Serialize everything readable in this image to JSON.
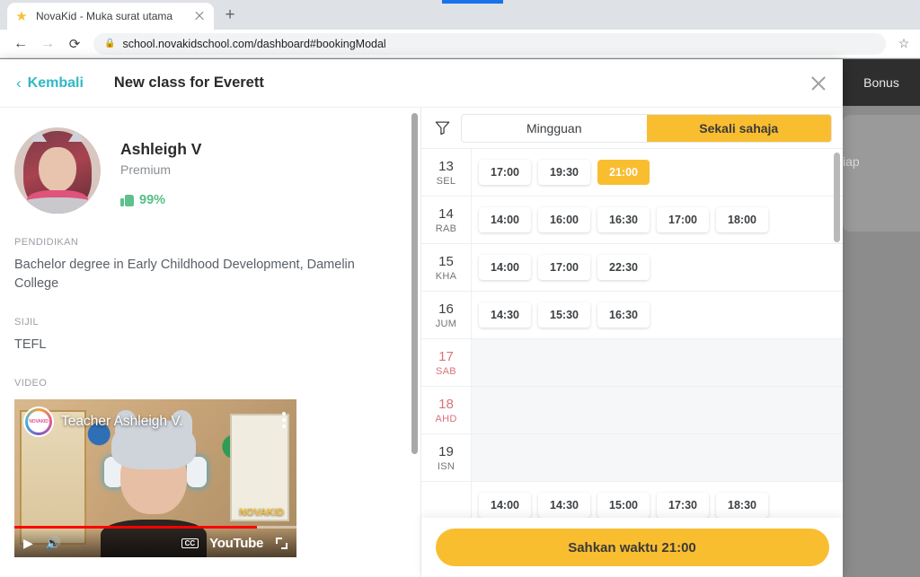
{
  "browser": {
    "tab": {
      "title": "NovaKid - Muka surat utama",
      "favicon": "star-icon"
    },
    "new_tab_label": "+",
    "nav": {
      "back": "←",
      "forward": "→",
      "reload": "⟳"
    },
    "omnibox": {
      "lock": "🔒",
      "url": "school.novakidschool.com/dashboard#bookingModal"
    },
    "bookmark_star": "☆"
  },
  "background": {
    "bonus_label": "Bonus",
    "partial_text": "iap"
  },
  "modal": {
    "back_label": "Kembali",
    "back_chevron": "‹",
    "title": "New class for Everett",
    "close_label": "×"
  },
  "teacher": {
    "name": "Ashleigh V",
    "plan": "Premium",
    "rating": "99%",
    "sections": [
      {
        "label": "PENDIDIKAN",
        "text": "Bachelor degree in Early Childhood Development, Damelin College"
      },
      {
        "label": "SIJIL",
        "text": "TEFL"
      }
    ],
    "video_section_label": "VIDEO",
    "video": {
      "title": "Teacher Ashleigh V.",
      "brand": "NOVAKID",
      "logo_text": "NOVAKID",
      "youtube_label": "YouTube",
      "cc_label": "CC",
      "play_icon": "▶",
      "volume_icon": "🔊",
      "progress_percent": 86
    }
  },
  "schedule": {
    "filter_icon": "funnel-icon",
    "tabs": [
      {
        "label": "Mingguan",
        "active": false
      },
      {
        "label": "Sekali sahaja",
        "active": true
      }
    ],
    "days": [
      {
        "num": "13",
        "dow": "SEL",
        "weekend": false,
        "slots": [
          {
            "time": "17:00",
            "selected": false
          },
          {
            "time": "19:30",
            "selected": false
          },
          {
            "time": "21:00",
            "selected": true
          }
        ]
      },
      {
        "num": "14",
        "dow": "RAB",
        "weekend": false,
        "slots": [
          {
            "time": "14:00",
            "selected": false
          },
          {
            "time": "16:00",
            "selected": false
          },
          {
            "time": "16:30",
            "selected": false
          },
          {
            "time": "17:00",
            "selected": false
          },
          {
            "time": "18:00",
            "selected": false
          }
        ]
      },
      {
        "num": "15",
        "dow": "KHA",
        "weekend": false,
        "slots": [
          {
            "time": "14:00",
            "selected": false
          },
          {
            "time": "17:00",
            "selected": false
          },
          {
            "time": "22:30",
            "selected": false
          }
        ]
      },
      {
        "num": "16",
        "dow": "JUM",
        "weekend": false,
        "slots": [
          {
            "time": "14:30",
            "selected": false
          },
          {
            "time": "15:30",
            "selected": false
          },
          {
            "time": "16:30",
            "selected": false
          }
        ]
      },
      {
        "num": "17",
        "dow": "SAB",
        "weekend": true,
        "slots": []
      },
      {
        "num": "18",
        "dow": "AHD",
        "weekend": true,
        "slots": []
      },
      {
        "num": "19",
        "dow": "ISN",
        "weekend": false,
        "slots": []
      },
      {
        "num": "",
        "dow": "",
        "weekend": false,
        "slots": [
          {
            "time": "14:00",
            "selected": false
          },
          {
            "time": "14:30",
            "selected": false
          },
          {
            "time": "15:00",
            "selected": false
          },
          {
            "time": "17:30",
            "selected": false
          },
          {
            "time": "18:30",
            "selected": false
          }
        ]
      }
    ],
    "confirm_label": "Sahkan waktu 21:00"
  },
  "colors": {
    "accent_yellow": "#f9bd30",
    "teal": "#2fb8c6",
    "green": "#55bf86",
    "weekend_red": "#d9737a"
  }
}
